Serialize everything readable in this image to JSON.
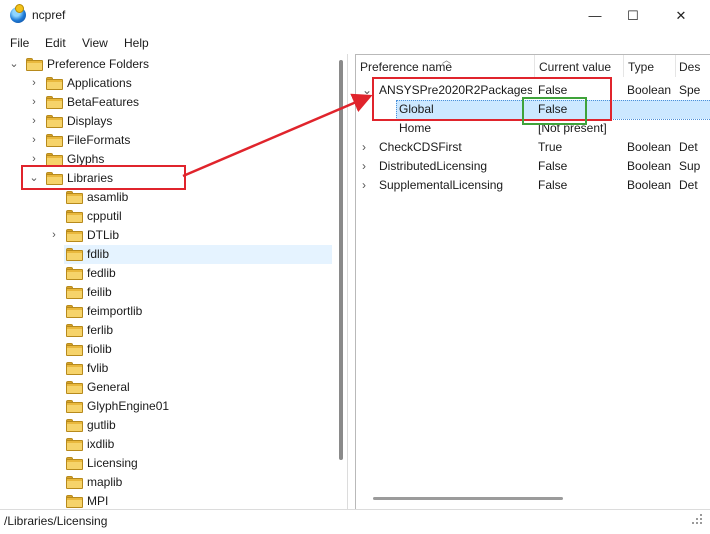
{
  "window": {
    "title": "ncpref",
    "min_glyph": "—",
    "max_glyph": "☐",
    "close_glyph": "✕"
  },
  "menu": {
    "file": "File",
    "edit": "Edit",
    "view": "View",
    "help": "Help"
  },
  "tree": {
    "root": "Preference Folders",
    "items": [
      "Applications",
      "BetaFeatures",
      "Displays",
      "FileFormats",
      "Glyphs",
      "Libraries"
    ],
    "libraries_children": [
      "asamlib",
      "cpputil",
      "DTLib",
      "fdlib",
      "fedlib",
      "feilib",
      "feimportlib",
      "ferlib",
      "fiolib",
      "fvlib",
      "General",
      "GlyphEngine01",
      "gutlib",
      "ixdlib",
      "Licensing",
      "maplib",
      "MPI"
    ]
  },
  "list": {
    "headers": {
      "name": "Preference name",
      "value": "Current value",
      "type": "Type",
      "desc": "Des"
    },
    "rows": [
      {
        "name": "ANSYSPre2020R2Packages",
        "value": "False",
        "type": "Boolean",
        "desc": "Spe"
      },
      {
        "name": "Global",
        "value": "False",
        "type": "",
        "desc": ""
      },
      {
        "name": "Home",
        "value": "[Not present]",
        "type": "",
        "desc": ""
      },
      {
        "name": "CheckCDSFirst",
        "value": "True",
        "type": "Boolean",
        "desc": "Det"
      },
      {
        "name": "DistributedLicensing",
        "value": "False",
        "type": "Boolean",
        "desc": "Sup"
      },
      {
        "name": "SupplementalLicensing",
        "value": "False",
        "type": "Boolean",
        "desc": "Det"
      }
    ]
  },
  "status_bar": {
    "path": "/Libraries/Licensing"
  },
  "colors": {
    "annotation_red": "#e0242c",
    "annotation_green": "#3fa33a",
    "selection": "#cce8ff"
  }
}
